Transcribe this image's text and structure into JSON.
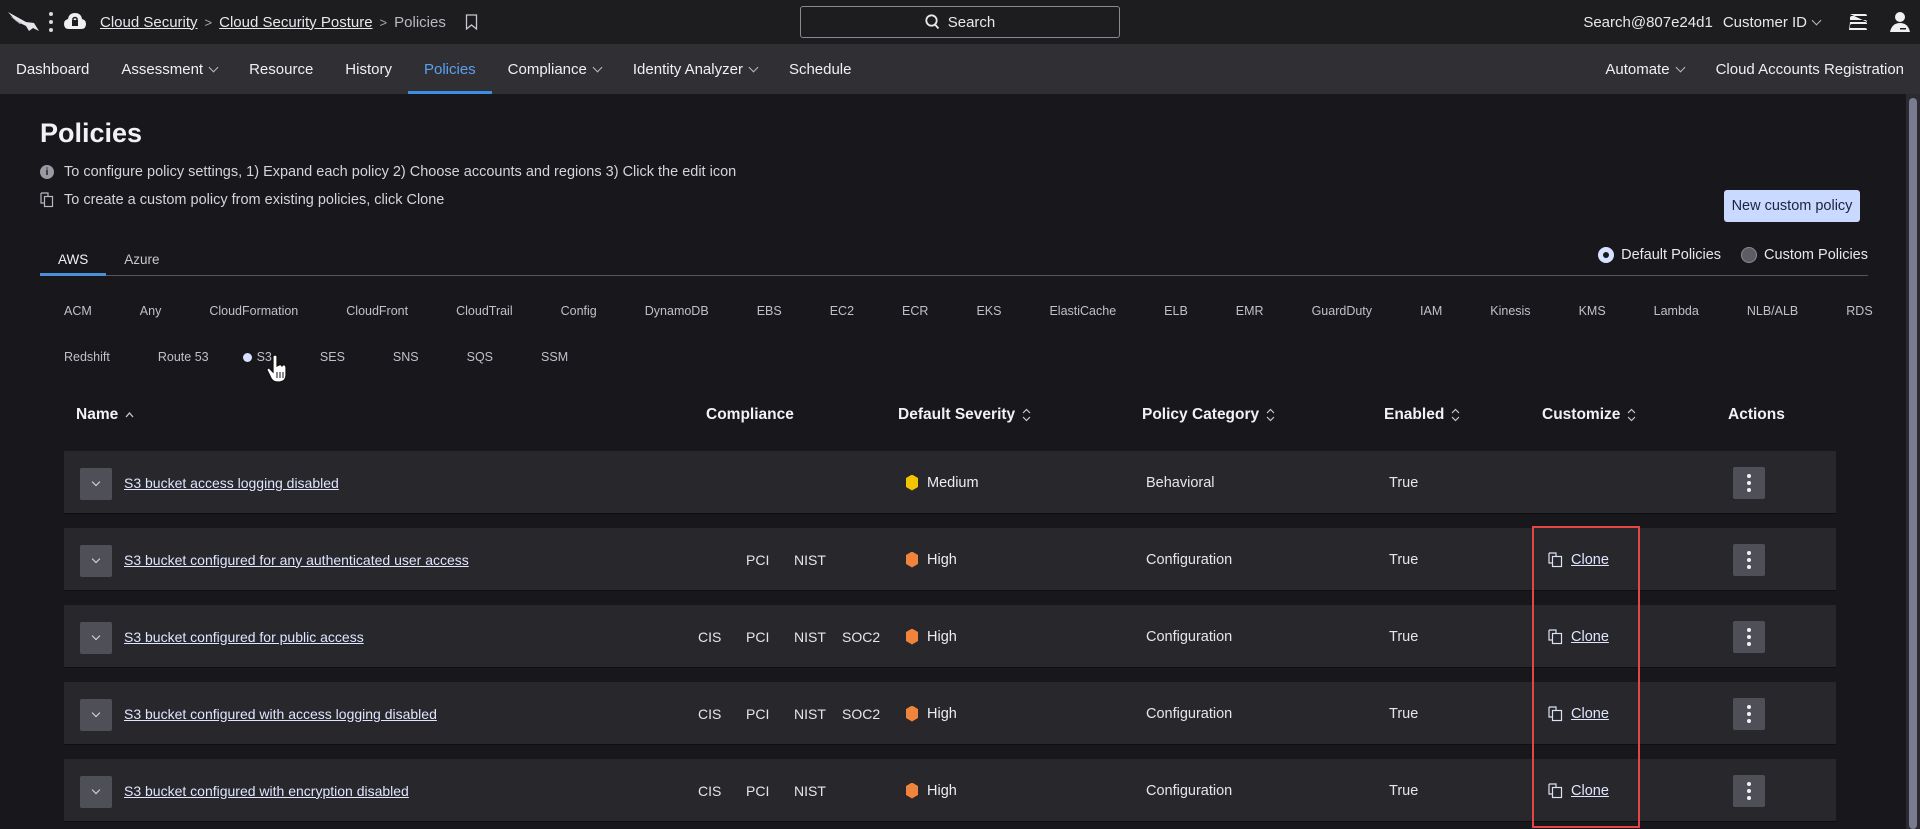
{
  "topbar": {
    "breadcrumbs": [
      "Cloud Security",
      "Cloud Security Posture",
      "Policies"
    ],
    "search_placeholder": "Search",
    "user": "Search@807e24d1",
    "customer_id": "Customer ID"
  },
  "nav": {
    "left": [
      {
        "label": "Dashboard",
        "dropdown": false,
        "active": false
      },
      {
        "label": "Assessment",
        "dropdown": true,
        "active": false
      },
      {
        "label": "Resource",
        "dropdown": false,
        "active": false
      },
      {
        "label": "History",
        "dropdown": false,
        "active": false
      },
      {
        "label": "Policies",
        "dropdown": false,
        "active": true
      },
      {
        "label": "Compliance",
        "dropdown": true,
        "active": false
      },
      {
        "label": "Identity Analyzer",
        "dropdown": true,
        "active": false
      },
      {
        "label": "Schedule",
        "dropdown": false,
        "active": false
      }
    ],
    "right": [
      {
        "label": "Automate",
        "dropdown": true
      },
      {
        "label": "Cloud Accounts Registration",
        "dropdown": false
      }
    ]
  },
  "page": {
    "title": "Policies",
    "hint_configure": "To configure policy settings, 1) Expand each policy 2) Choose accounts and regions 3) Click the edit icon",
    "hint_clone": "To create a custom policy from existing policies, click Clone",
    "new_policy_label": "New custom policy",
    "info_glyph": "i"
  },
  "tabs": [
    {
      "label": "AWS",
      "active": true
    },
    {
      "label": "Azure",
      "active": false
    }
  ],
  "policy_type": {
    "options": [
      "Default Policies",
      "Custom Policies"
    ],
    "selected": "Default Policies"
  },
  "services": {
    "row1": [
      "ACM",
      "Any",
      "CloudFormation",
      "CloudFront",
      "CloudTrail",
      "Config",
      "DynamoDB",
      "EBS",
      "EC2",
      "ECR",
      "EKS",
      "ElastiCache",
      "ELB",
      "EMR",
      "GuardDuty",
      "IAM",
      "Kinesis",
      "KMS",
      "Lambda",
      "NLB/ALB",
      "RDS"
    ],
    "row2": [
      "Redshift",
      "Route 53",
      "S3",
      "SES",
      "SNS",
      "SQS",
      "SSM"
    ],
    "selected": "S3"
  },
  "table": {
    "headers": {
      "name": "Name",
      "compliance": "Compliance",
      "severity": "Default Severity",
      "category": "Policy Category",
      "enabled": "Enabled",
      "customize": "Customize",
      "actions": "Actions"
    },
    "severity_colors": {
      "Medium": "#f5c400",
      "High": "#f0843c"
    },
    "rows": [
      {
        "name": "S3 bucket access logging disabled",
        "cis": "",
        "pci": "",
        "nist": "",
        "soc2": "",
        "severity": "Medium",
        "category": "Behavioral",
        "enabled": "True",
        "customize": ""
      },
      {
        "name": "S3 bucket configured for any authenticated user access",
        "cis": "",
        "pci": "PCI",
        "nist": "NIST",
        "soc2": "",
        "severity": "High",
        "category": "Configuration",
        "enabled": "True",
        "customize": "Clone"
      },
      {
        "name": "S3 bucket configured for public access",
        "cis": "CIS",
        "pci": "PCI",
        "nist": "NIST",
        "soc2": "SOC2",
        "severity": "High",
        "category": "Configuration",
        "enabled": "True",
        "customize": "Clone"
      },
      {
        "name": "S3 bucket configured with access logging disabled",
        "cis": "CIS",
        "pci": "PCI",
        "nist": "NIST",
        "soc2": "SOC2",
        "severity": "High",
        "category": "Configuration",
        "enabled": "True",
        "customize": "Clone"
      },
      {
        "name": "S3 bucket configured with encryption disabled",
        "cis": "CIS",
        "pci": "PCI",
        "nist": "NIST",
        "soc2": "",
        "severity": "High",
        "category": "Configuration",
        "enabled": "True",
        "customize": "Clone"
      }
    ]
  },
  "colors": {
    "accent": "#3d8ee6",
    "highlight": "#e64545",
    "button_primary": "#c9d9ff"
  }
}
